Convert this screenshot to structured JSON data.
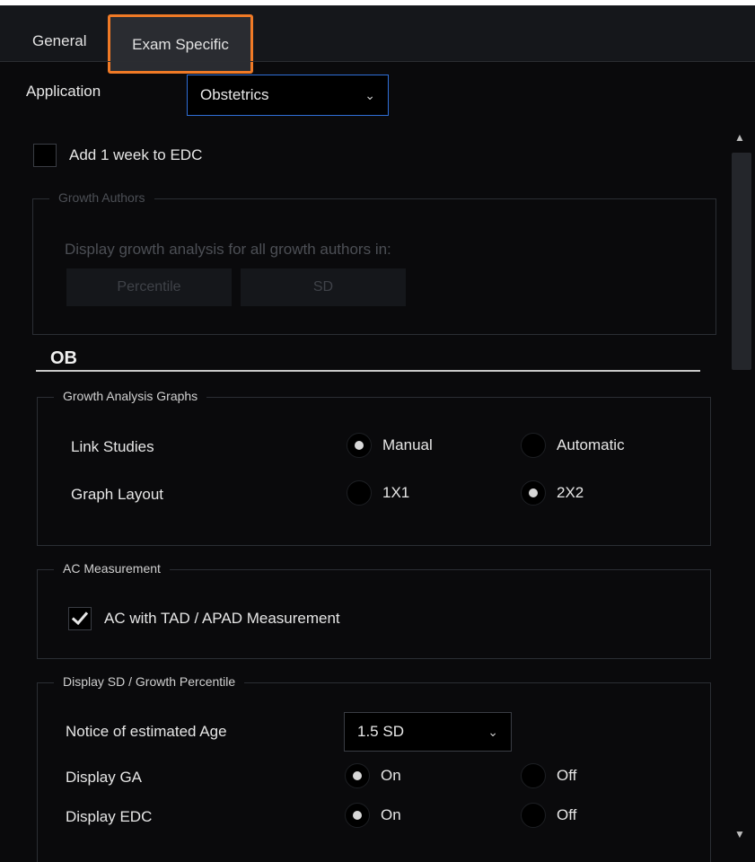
{
  "tabs": [
    {
      "label": "General"
    },
    {
      "label": "Exam Specific"
    }
  ],
  "application": {
    "label": "Application",
    "selected": "Obstetrics"
  },
  "add_week": {
    "label": "Add 1 week to EDC",
    "checked": false
  },
  "growth_authors": {
    "title": "Growth Authors",
    "description": "Display growth analysis for all growth authors in:",
    "buttons": [
      "Percentile",
      "SD"
    ]
  },
  "ob": {
    "title": "OB",
    "growth_graphs": {
      "title": "Growth Analysis Graphs",
      "link_studies": {
        "label": "Link Studies",
        "options": [
          "Manual",
          "Automatic"
        ],
        "selected": "Manual"
      },
      "graph_layout": {
        "label": "Graph Layout",
        "options": [
          "1X1",
          "2X2"
        ],
        "selected": "2X2"
      }
    },
    "ac_measurement": {
      "title": "AC Measurement",
      "checkbox_label": "AC with TAD / APAD Measurement",
      "checked": true
    },
    "display_sd": {
      "title": "Display SD / Growth Percentile",
      "notice_label": "Notice of estimated Age",
      "notice_value": "1.5 SD",
      "display_ga": {
        "label": "Display GA",
        "options": [
          "On",
          "Off"
        ],
        "selected": "On"
      },
      "display_edc": {
        "label": "Display EDC",
        "options": [
          "On",
          "Off"
        ],
        "selected": "On"
      }
    }
  },
  "icons": {
    "chevron": "chevron-down-icon",
    "check": "check-icon"
  },
  "colors": {
    "tab_highlight": "#f07a26",
    "dropdown_focus": "#2f6fd8"
  }
}
